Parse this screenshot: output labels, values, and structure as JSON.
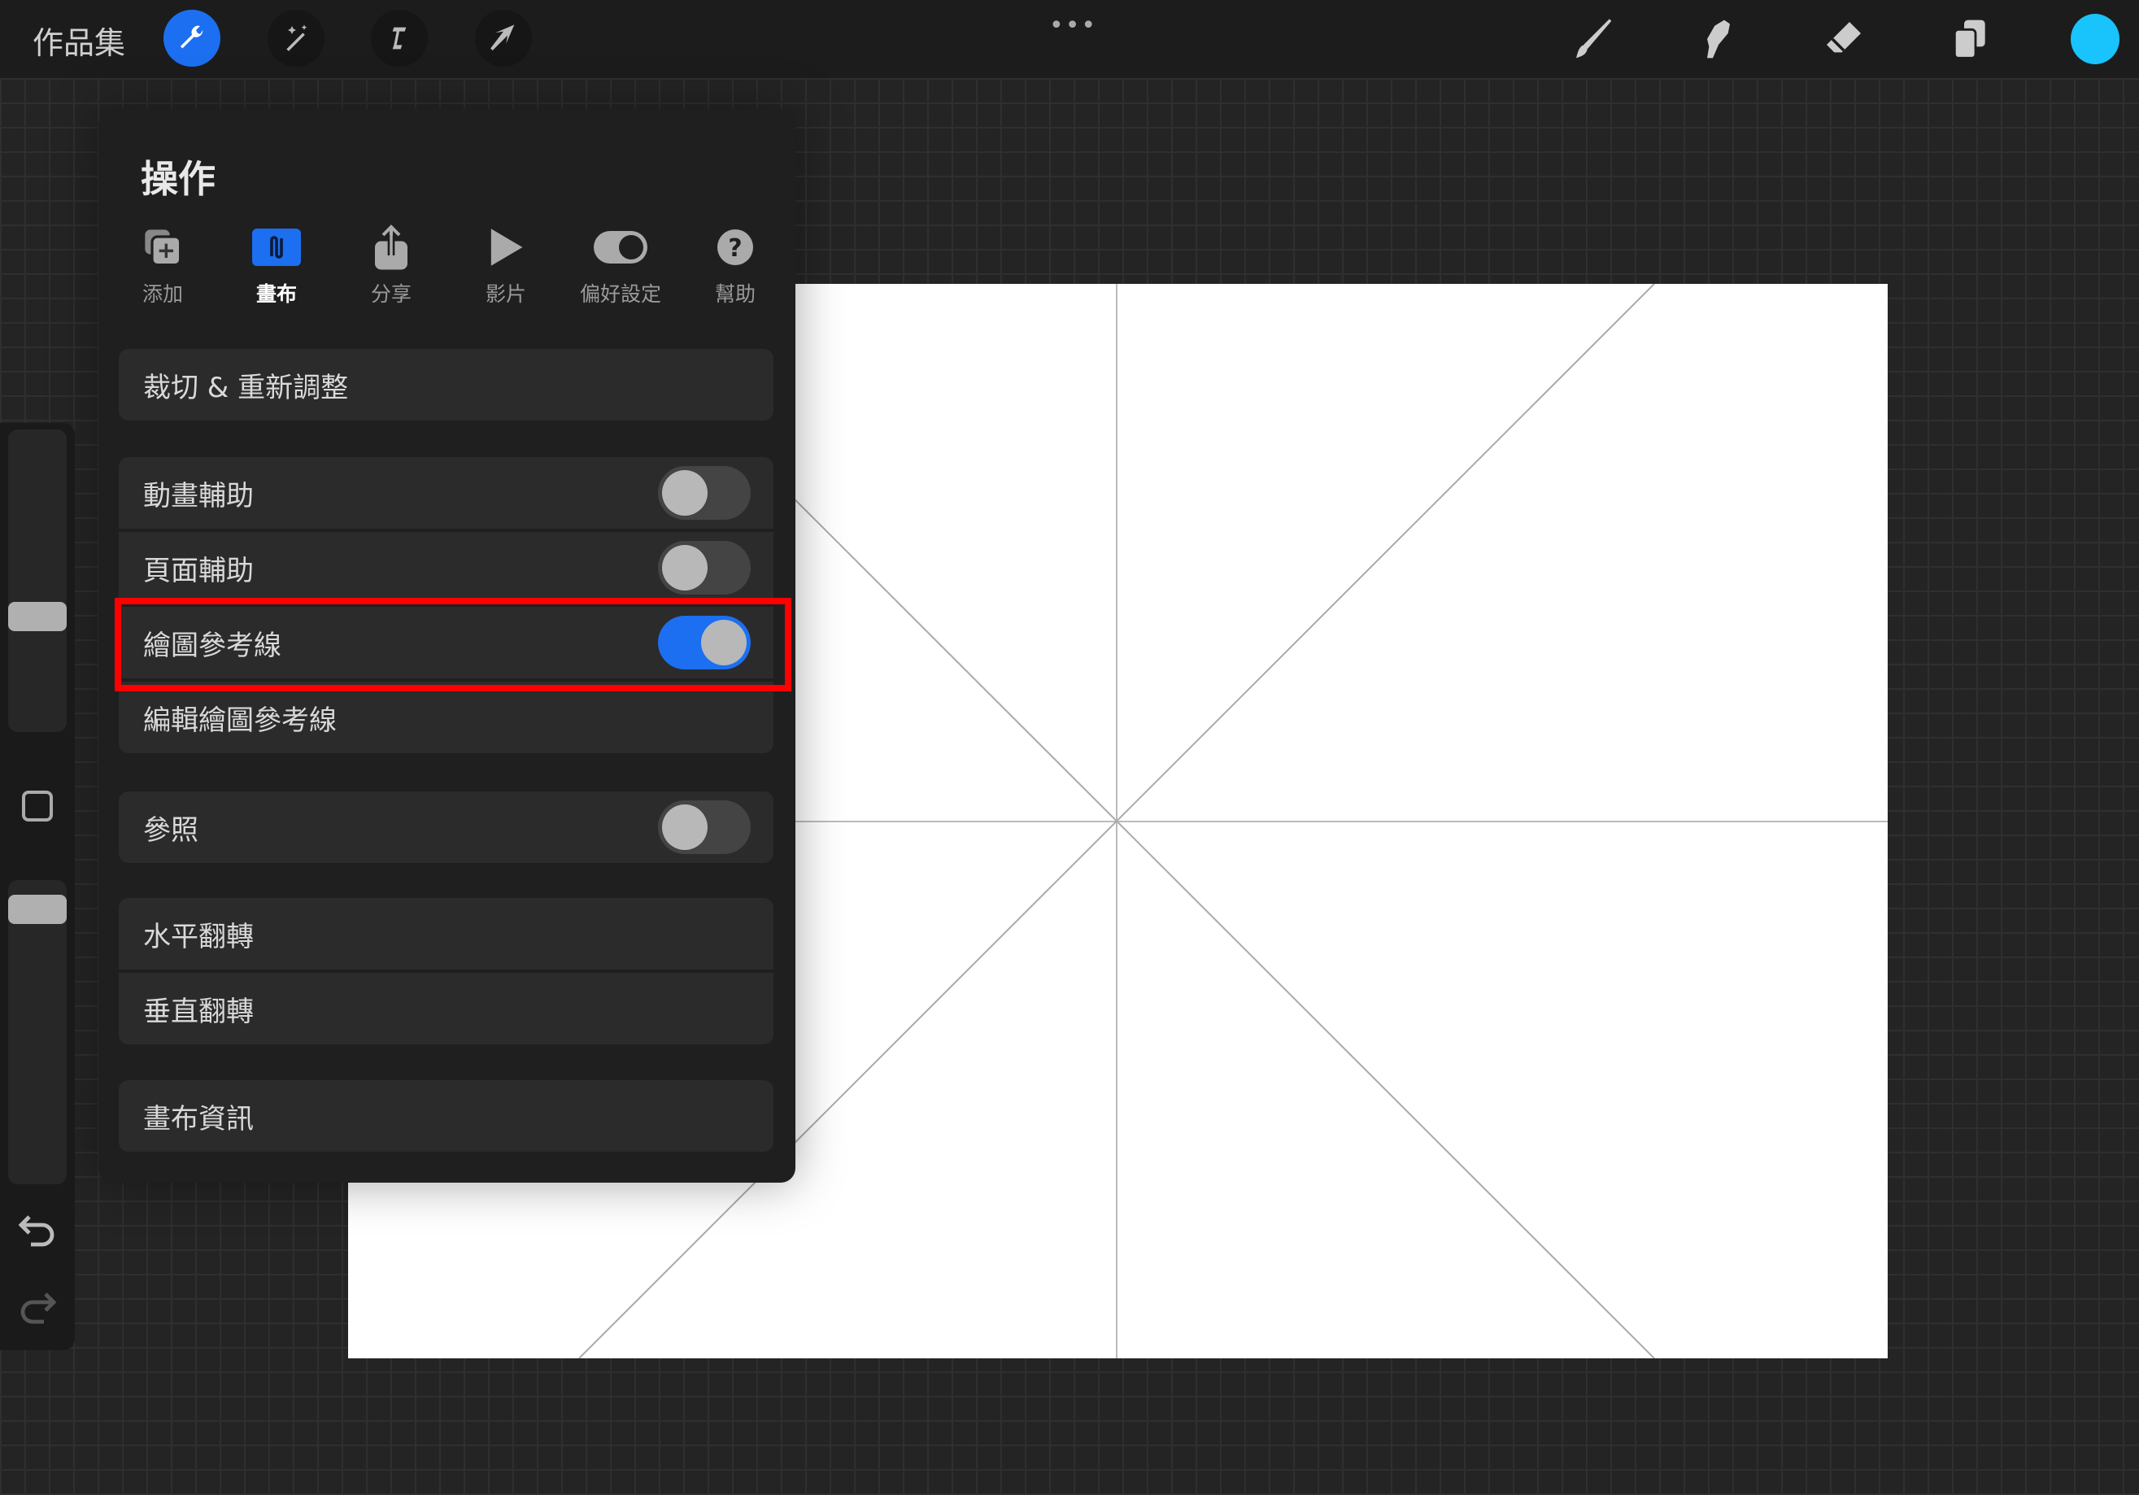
{
  "topbar": {
    "gallery_label": "作品集",
    "left_tools": [
      {
        "icon": "wrench-icon",
        "name": "actions",
        "active": true
      },
      {
        "icon": "magic-wand-icon",
        "name": "adjustments",
        "active": false
      },
      {
        "icon": "selection-icon",
        "name": "selection",
        "active": false
      },
      {
        "icon": "transform-arrow-icon",
        "name": "transform",
        "active": false
      }
    ],
    "more_icon": "ellipsis-icon",
    "right_tools": [
      "brush-icon",
      "smudge-icon",
      "eraser-icon",
      "layers-icon"
    ],
    "current_color": "#19c3fb"
  },
  "panel": {
    "title": "操作",
    "tabs": [
      {
        "label": "添加",
        "icon": "add-icon",
        "active": false
      },
      {
        "label": "畫布",
        "icon": "canvas-icon",
        "active": true
      },
      {
        "label": "分享",
        "icon": "share-icon",
        "active": false
      },
      {
        "label": "影片",
        "icon": "play-icon",
        "active": false
      },
      {
        "label": "偏好設定",
        "icon": "toggle-icon",
        "active": false
      },
      {
        "label": "幫助",
        "icon": "help-icon",
        "active": false
      }
    ],
    "rows": {
      "crop": "裁切 & 重新調整",
      "animation": "動畫輔助",
      "animation_on": false,
      "page": "頁面輔助",
      "page_on": false,
      "guide": "繪圖參考線",
      "guide_on": true,
      "edit_guide": "編輯繪圖參考線",
      "reference": "參照",
      "reference_on": false,
      "flip_h": "水平翻轉",
      "flip_v": "垂直翻轉",
      "canvas_info": "畫布資訊"
    }
  },
  "colors": {
    "accent": "#1c6ff0",
    "highlight": "#ff0000"
  }
}
